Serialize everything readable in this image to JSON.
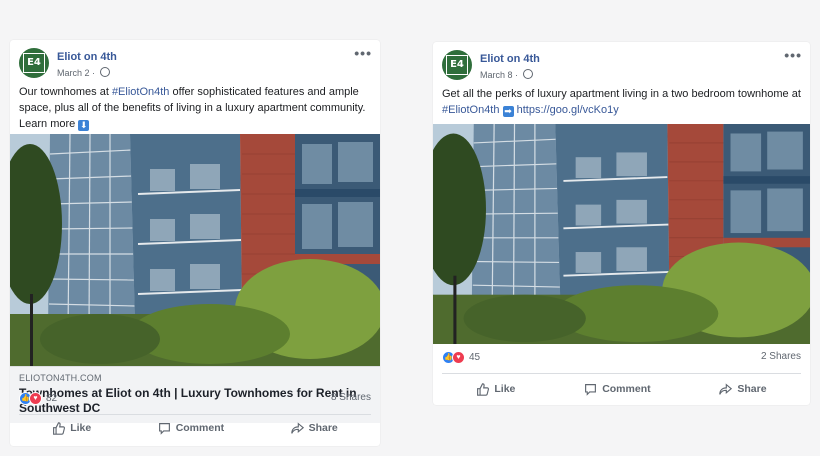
{
  "posts": [
    {
      "page_name": "Eliot on 4th",
      "avatar_text": "E4",
      "date": "March 2",
      "text_pre": "Our townhomes at ",
      "hashtag": "#EliotOn4th",
      "text_post": " offer sophisticated features and ample space, plus all of the benefits of living in a luxury apartment community.",
      "learn_more": "Learn more",
      "learn_more_emoji": "⬇",
      "link_domain": "ELIOTON4TH.COM",
      "link_title": "Townhomes at Eliot on 4th | Luxury Townhomes for Rent in Southwest DC",
      "reaction_count": "82",
      "shares": "8 Shares",
      "actions": {
        "like": "Like",
        "comment": "Comment",
        "share": "Share"
      }
    },
    {
      "page_name": "Eliot on 4th",
      "avatar_text": "E4",
      "date": "March 8",
      "text_pre": "Get all the perks of luxury apartment living in a two bedroom townhome at ",
      "hashtag": "#EliotOn4th",
      "arrow_emoji": "➡",
      "url": "https://goo.gl/vcKo1y",
      "reaction_count": "45",
      "shares": "2 Shares",
      "actions": {
        "like": "Like",
        "comment": "Comment",
        "share": "Share"
      }
    }
  ],
  "colors": {
    "link": "#385898",
    "like_blue": "#2e81f4",
    "love_red": "#ee3c50",
    "brick": "#a5493a"
  },
  "icons": [
    "globe-icon",
    "more-options-icon",
    "like-icon",
    "comment-icon",
    "share-icon",
    "down-arrow-emoji-icon",
    "right-arrow-emoji-icon"
  ]
}
